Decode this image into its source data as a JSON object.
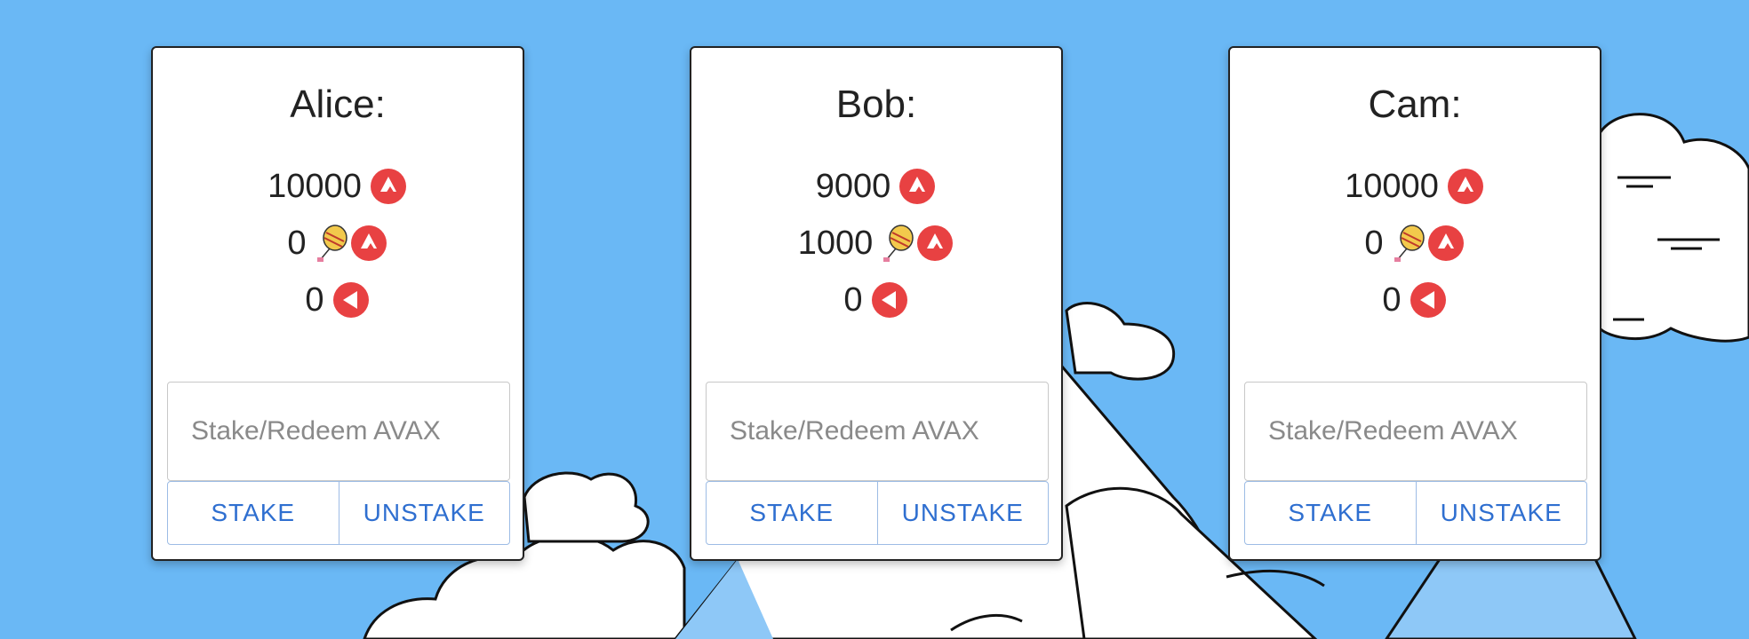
{
  "colors": {
    "background": "#6ab8f5",
    "avax_red": "#e84142",
    "button_text": "#2f6fd0"
  },
  "icons": {
    "avax": "avax-icon",
    "savax": "balloon-avax-icon",
    "back": "back-arrow-icon"
  },
  "cards": [
    {
      "title": "Alice:",
      "avax": "10000",
      "savax": "0",
      "pending": "0",
      "placeholder": "Stake/Redeem AVAX",
      "stake_label": "STAKE",
      "unstake_label": "UNSTAKE"
    },
    {
      "title": "Bob:",
      "avax": "9000",
      "savax": "1000",
      "pending": "0",
      "placeholder": "Stake/Redeem AVAX",
      "stake_label": "STAKE",
      "unstake_label": "UNSTAKE"
    },
    {
      "title": "Cam:",
      "avax": "10000",
      "savax": "0",
      "pending": "0",
      "placeholder": "Stake/Redeem AVAX",
      "stake_label": "STAKE",
      "unstake_label": "UNSTAKE"
    }
  ]
}
